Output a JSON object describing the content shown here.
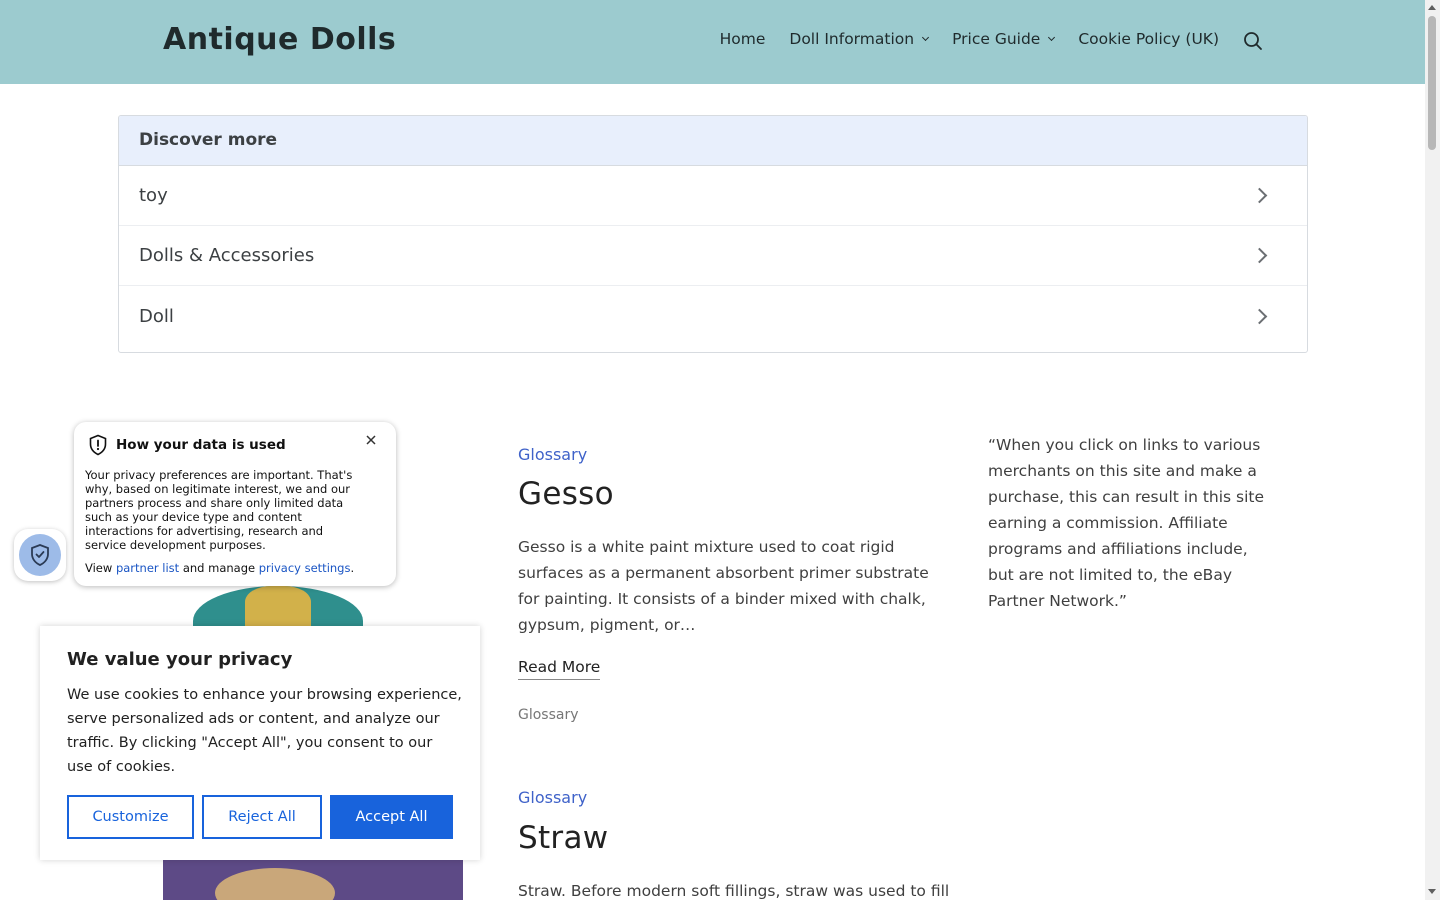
{
  "header": {
    "site_title": "Antique Dolls",
    "nav": [
      "Home",
      "Doll Information",
      "Price Guide",
      "Cookie Policy (UK)"
    ]
  },
  "discover": {
    "heading": "Discover more",
    "items": [
      "toy",
      "Dolls & Accessories",
      "Doll"
    ]
  },
  "posts": [
    {
      "category": "Glossary",
      "title": "Gesso",
      "excerpt": "Gesso is a white paint mixture used to coat rigid surfaces as a permanent absorbent primer substrate for painting. It consists of a binder mixed with chalk, gypsum, pigment, or…",
      "read_more": "Read More",
      "tag": "Glossary"
    },
    {
      "category": "Glossary",
      "title": "Straw",
      "excerpt": "Straw. Before modern soft fillings, straw was used to fill"
    }
  ],
  "affiliate_text": "“When you click on links to various merchants on this site and make a purchase, this can result in this site earning a commission.  Affiliate programs and affiliations include, but are not limited to, the eBay Partner Network.”",
  "data_popup": {
    "title": "How your data is used",
    "body": "Your privacy preferences are important. That's why, based on legitimate interest, we and our partners process and share only limited data such as your device type and content interactions for advertising, research and service development purposes.",
    "links_prefix": "View ",
    "partner_link": "partner list",
    "links_middle": " and manage ",
    "settings_link": "privacy settings",
    "links_suffix": "."
  },
  "cookie_banner": {
    "title": "We value your privacy",
    "text": "We use cookies to enhance your browsing experience, serve personalized ads or content, and analyze our traffic. By clicking \"Accept All\", you consent to our use of cookies.",
    "customize": "Customize",
    "reject": "Reject All",
    "accept": "Accept All"
  },
  "icons": {
    "search": "search-icon",
    "chevron": "chevron-down-icon",
    "row_chevron": "chevron-right-icon",
    "shield": "shield-icon",
    "close": "close-icon"
  },
  "colors": {
    "header_bg": "#9ccbcf",
    "link_blue": "#3f62c9",
    "cookie_blue": "#1863dc",
    "discover_head_bg": "#e8effc"
  }
}
